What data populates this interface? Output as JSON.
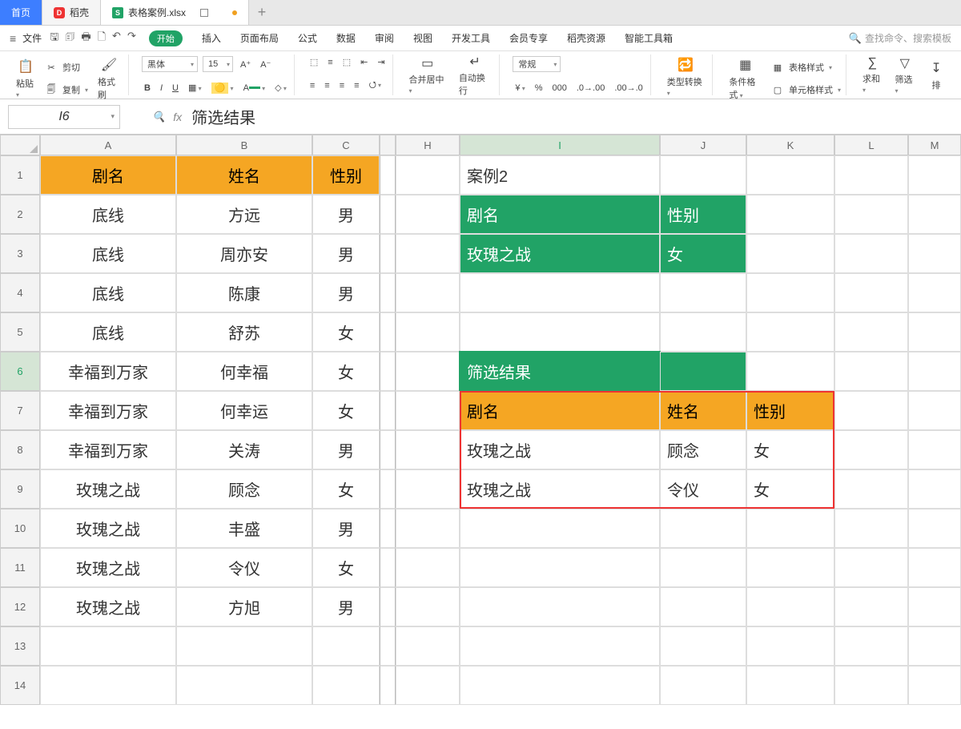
{
  "tabs": {
    "home": "首页",
    "docker": "稻壳",
    "file": "表格案例.xlsx"
  },
  "menus": {
    "file": "文件",
    "start": "开始",
    "insert": "插入",
    "layout": "页面布局",
    "formula": "公式",
    "data": "数据",
    "review": "审阅",
    "view": "视图",
    "dev": "开发工具",
    "vip": "会员专享",
    "res": "稻壳资源",
    "smart": "智能工具箱",
    "search_ph": "查找命令、搜索模板"
  },
  "ribbon": {
    "paste": "粘贴",
    "cut": "剪切",
    "copy": "复制",
    "format_painter": "格式刷",
    "font_name": "黑体",
    "font_size": "15",
    "merge": "合并居中",
    "wrap": "自动换行",
    "number_fmt": "常规",
    "type_convert": "类型转换",
    "cond_fmt": "条件格式",
    "table_style": "表格样式",
    "cell_style": "单元格样式",
    "sum": "求和",
    "filter": "筛选",
    "sort": "排"
  },
  "formula_bar": {
    "name": "I6",
    "value": "筛选结果"
  },
  "columns": [
    "A",
    "B",
    "C",
    "H",
    "I",
    "J",
    "K",
    "L",
    "M"
  ],
  "rows": [
    "1",
    "2",
    "3",
    "4",
    "5",
    "6",
    "7",
    "8",
    "9",
    "10",
    "11",
    "12",
    "13",
    "14"
  ],
  "table1": {
    "header": [
      "剧名",
      "姓名",
      "性别"
    ],
    "rows": [
      [
        "底线",
        "方远",
        "男"
      ],
      [
        "底线",
        "周亦安",
        "男"
      ],
      [
        "底线",
        "陈康",
        "男"
      ],
      [
        "底线",
        "舒苏",
        "女"
      ],
      [
        "幸福到万家",
        "何幸福",
        "女"
      ],
      [
        "幸福到万家",
        "何幸运",
        "女"
      ],
      [
        "幸福到万家",
        "关涛",
        "男"
      ],
      [
        "玫瑰之战",
        "顾念",
        "女"
      ],
      [
        "玫瑰之战",
        "丰盛",
        "男"
      ],
      [
        "玫瑰之战",
        "令仪",
        "女"
      ],
      [
        "玫瑰之战",
        "方旭",
        "男"
      ]
    ]
  },
  "case2_title": "案例2",
  "criteria": {
    "header": [
      "剧名",
      "性别"
    ],
    "row": [
      "玫瑰之战",
      "女"
    ]
  },
  "result_title": "筛选结果",
  "result": {
    "header": [
      "剧名",
      "姓名",
      "性别"
    ],
    "rows": [
      [
        "玫瑰之战",
        "顾念",
        "女"
      ],
      [
        "玫瑰之战",
        "令仪",
        "女"
      ]
    ]
  },
  "active_cell": "I6"
}
